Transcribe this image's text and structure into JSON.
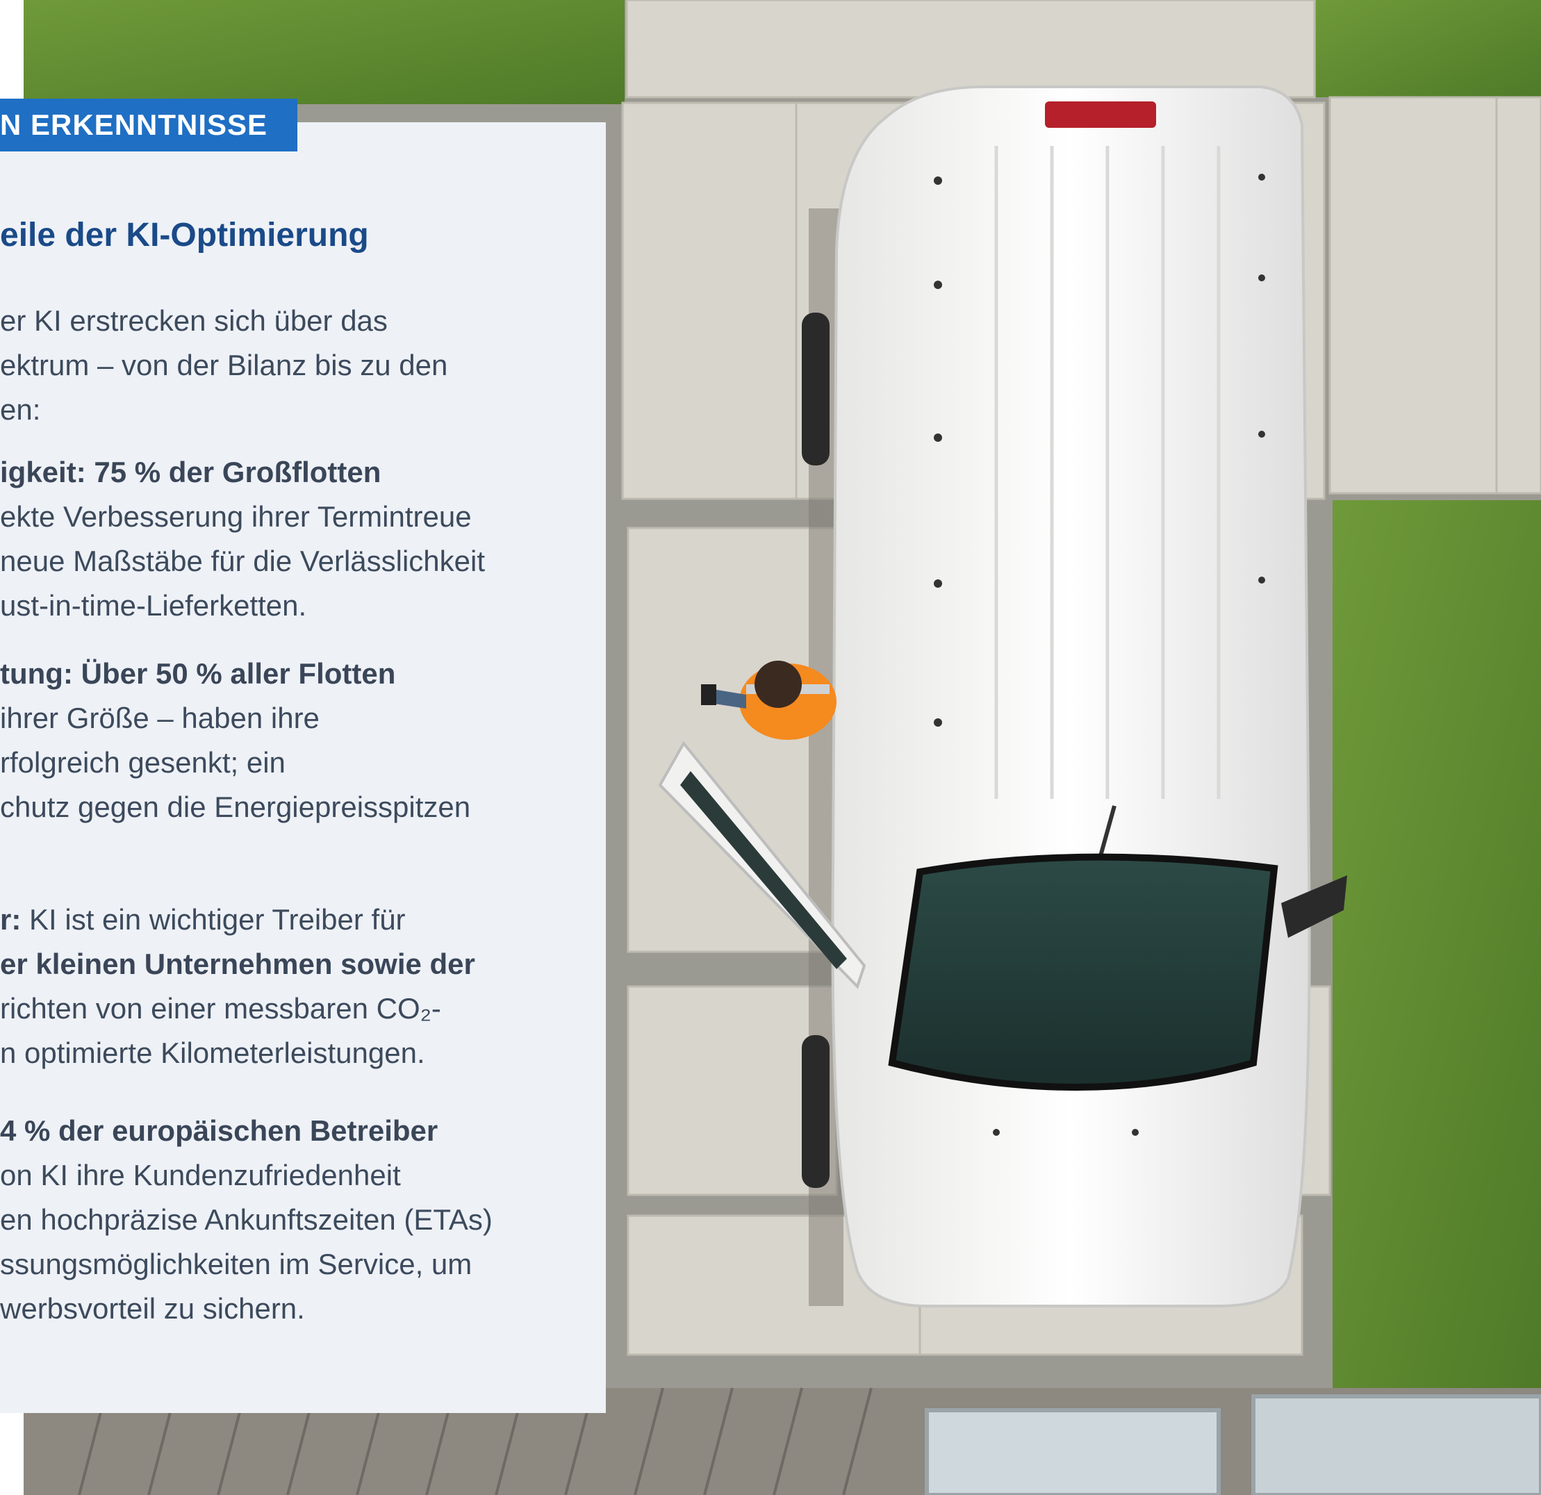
{
  "card": {
    "badge": "N ERKENNTNISSE",
    "title": "eile der KI-Optimierung",
    "intro": [
      "er KI erstrecken sich über das",
      "ektrum – von der Bilanz bis zu den",
      "en:"
    ],
    "items": [
      {
        "bold": "igkeit: 75 % der Großflotten",
        "lines": [
          "ekte Verbesserung ihrer Termintreue",
          "neue Maßstäbe für die Verlässlichkeit",
          "ust-in-time-Lieferketten."
        ]
      },
      {
        "bold": "tung: Über 50 % aller Flotten",
        "lines": [
          "ihrer Größe – haben ihre",
          "rfolgreich gesenkt; ein",
          "chutz gegen die Energiepreisspitzen"
        ]
      },
      {
        "bold_prefix": "r:",
        "first_line_rest": " KI ist ein wichtiger Treiber für",
        "bold_line": "er kleinen Unternehmen sowie der",
        "lines": [
          "richten von einer messbaren CO₂-",
          "n optimierte Kilometerleistungen."
        ]
      },
      {
        "bold": "4 % der europäischen Betreiber",
        "lines": [
          "on KI ihre Kundenzufriedenheit",
          "en hochpräzise Ankunftszeiten (ETAs)",
          "ssungsmöglichkeiten im Service, um",
          "werbsvorteil zu sichern."
        ]
      }
    ]
  },
  "colors": {
    "badge_bg": "#1f6fc4",
    "title": "#1a4a88",
    "card_bg": "#eef1f6",
    "body_text": "#3c4a5c"
  }
}
